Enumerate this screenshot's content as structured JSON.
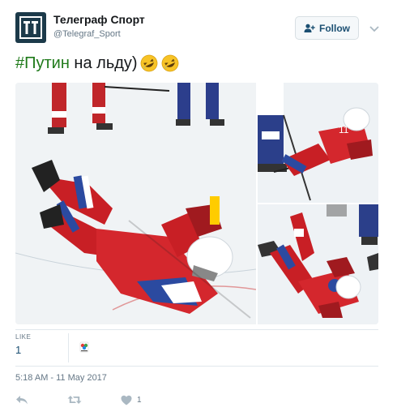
{
  "account": {
    "name": "Телеграф Спорт",
    "handle": "@Telegraf_Sport",
    "avatar_icon": "telegraf-logo-icon",
    "avatar_color": "#1c3a4a"
  },
  "follow_button": {
    "label": "Follow",
    "icon": "add-user-icon",
    "text_color": "#1b4f72"
  },
  "menu": {
    "icon": "chevron-down-icon"
  },
  "tweet": {
    "hashtag": "#Путин",
    "text": " на льду)",
    "emojis": [
      "rolling-on-floor-laughing-icon",
      "rolling-on-floor-laughing-icon"
    ],
    "hashtag_color": "#1f7a1a"
  },
  "media": {
    "photos": [
      {
        "name": "hockey-player-falling-on-ice"
      },
      {
        "name": "hockey-player-sliding-on-ice"
      },
      {
        "name": "hockey-player-lying-on-ice"
      }
    ]
  },
  "stats": {
    "likes_label": "LIKE",
    "likes_count": "1"
  },
  "timestamp": "5:18 AM - 11 May 2017",
  "actions": {
    "reply_icon": "reply-icon",
    "retweet_icon": "retweet-icon",
    "like_icon": "heart-icon",
    "like_count": "1"
  }
}
